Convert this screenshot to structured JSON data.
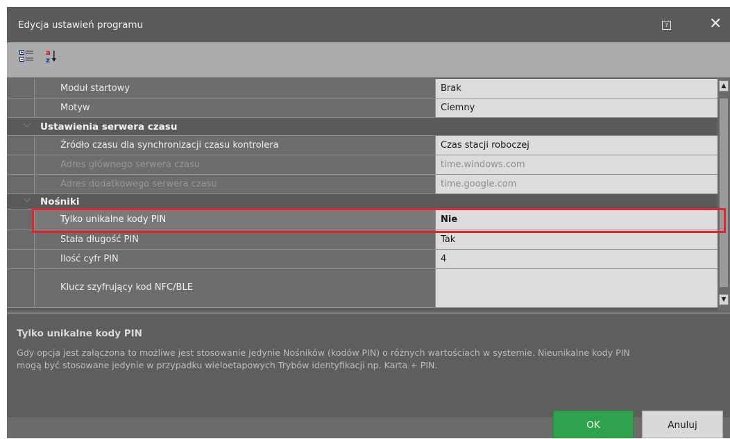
{
  "window": {
    "title": "Edycja ustawień programu",
    "help_glyph": "?",
    "close_glyph": "✕"
  },
  "toolbar": {
    "categorized_icon": "categorized-view-icon",
    "sort_icon": "sort-alpha-icon",
    "sort_a": "a",
    "sort_z": "z"
  },
  "grid": {
    "rows_top": [
      {
        "name": "Moduł startowy",
        "value": "Brak",
        "disabled": false
      },
      {
        "name": "Motyw",
        "value": "Ciemny",
        "disabled": false
      }
    ],
    "categories": [
      {
        "label": "Ustawienia serwera czasu",
        "rows": [
          {
            "name": "Źródło czasu dla synchronizacji czasu kontrolera",
            "value": "Czas stacji roboczej",
            "disabled": false
          },
          {
            "name": "Adres głównego serwera czasu",
            "value": "time.windows.com",
            "disabled": true
          },
          {
            "name": "Adres dodatkowego serwera czasu",
            "value": "time.google.com",
            "disabled": true
          }
        ]
      },
      {
        "label": "Nośniki",
        "rows": [
          {
            "name": "Tylko unikalne kody PIN",
            "value": "Nie",
            "selected": true
          },
          {
            "name": "Stała długość PIN",
            "value": "Tak"
          },
          {
            "name": "Ilość cyfr PIN",
            "value": "4"
          },
          {
            "name": "Klucz szyfrujący kod NFC/BLE",
            "value": ""
          }
        ]
      }
    ]
  },
  "description": {
    "title": "Tylko unikalne kody PIN",
    "line1": "Gdy opcja jest załączona to możliwe jest stosowanie jedynie Nośników (kodów PIN) o różnych wartościach w systemie. Nieunikalne kody PIN",
    "line2": "mogą być stosowane jedynie w przypadku wieloetapowych Trybów identyfikacji np. Karta + PIN."
  },
  "buttons": {
    "ok": "OK",
    "cancel": "Anuluj"
  },
  "colors": {
    "ok_green": "#2ea24d",
    "highlight_red": "#e0262c"
  }
}
